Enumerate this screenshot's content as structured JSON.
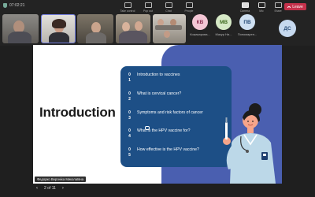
{
  "status": {
    "timer": "07:02:21"
  },
  "toolbar": {
    "items": [
      {
        "label": "Take control",
        "icon": "take-control-icon"
      },
      {
        "label": "Pop out",
        "icon": "pop-out-icon"
      },
      {
        "label": "Chat",
        "icon": "chat-icon"
      },
      {
        "label": "People",
        "icon": "people-icon"
      },
      {
        "label": "Raise",
        "icon": "raise-hand-icon"
      },
      {
        "label": "React",
        "icon": "react-icon"
      },
      {
        "label": "View",
        "icon": "view-icon"
      }
    ],
    "right_items": [
      {
        "label": "Camera",
        "icon": "camera-icon"
      },
      {
        "label": "Mic",
        "icon": "mic-icon"
      },
      {
        "label": "Share",
        "icon": "share-icon"
      }
    ],
    "leave_label": "Leave"
  },
  "participants": {
    "avatars": [
      {
        "initials": "КВ",
        "name": "Кожакарова...",
        "bg": "#f3c6d5",
        "fg": "#8a2d4f"
      },
      {
        "initials": "МВ",
        "name": "Мазур Ни...",
        "bg": "#d6e9c6",
        "fg": "#3f6b1f"
      },
      {
        "initials": "ПВ",
        "name": "Пономарен...",
        "bg": "#cfe0f2",
        "fg": "#274c78"
      }
    ],
    "extra": {
      "initials": "ДС",
      "bg": "#c6d9ef",
      "fg": "#2b4f7a"
    }
  },
  "slide": {
    "title": "Introduction",
    "agenda": [
      {
        "num": "01",
        "text": "Introduction to vaccines"
      },
      {
        "num": "02",
        "text": "What is cervical cancer?"
      },
      {
        "num": "03",
        "text": "Symptoms and risk factors of cancer"
      },
      {
        "num": "04",
        "text": "What is the HPV vaccine for?"
      },
      {
        "num": "05",
        "text": "How effective is the HPV vaccine?"
      }
    ]
  },
  "presenter_name": "Федорко Вероніка Миколаївна",
  "pager": {
    "prev": "‹",
    "page": "2 of 11",
    "next": "›"
  },
  "colors": {
    "slide_accent": "#4a5fb0",
    "agenda_bg": "#1d4f86",
    "leave": "#c4314b"
  }
}
